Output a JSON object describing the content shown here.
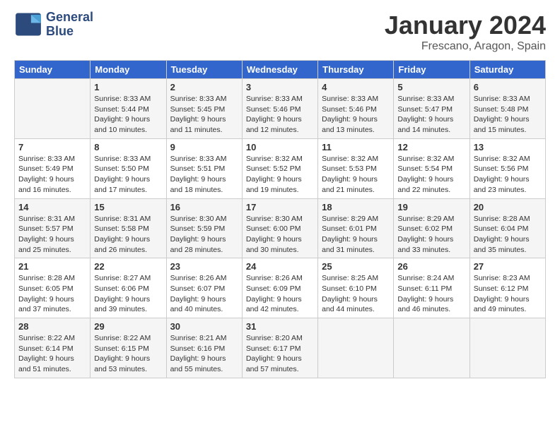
{
  "header": {
    "logo_line1": "General",
    "logo_line2": "Blue",
    "title": "January 2024",
    "location": "Frescano, Aragon, Spain"
  },
  "weekdays": [
    "Sunday",
    "Monday",
    "Tuesday",
    "Wednesday",
    "Thursday",
    "Friday",
    "Saturday"
  ],
  "weeks": [
    [
      {
        "day": "",
        "sunrise": "",
        "sunset": "",
        "daylight": ""
      },
      {
        "day": "1",
        "sunrise": "Sunrise: 8:33 AM",
        "sunset": "Sunset: 5:44 PM",
        "daylight": "Daylight: 9 hours and 10 minutes."
      },
      {
        "day": "2",
        "sunrise": "Sunrise: 8:33 AM",
        "sunset": "Sunset: 5:45 PM",
        "daylight": "Daylight: 9 hours and 11 minutes."
      },
      {
        "day": "3",
        "sunrise": "Sunrise: 8:33 AM",
        "sunset": "Sunset: 5:46 PM",
        "daylight": "Daylight: 9 hours and 12 minutes."
      },
      {
        "day": "4",
        "sunrise": "Sunrise: 8:33 AM",
        "sunset": "Sunset: 5:46 PM",
        "daylight": "Daylight: 9 hours and 13 minutes."
      },
      {
        "day": "5",
        "sunrise": "Sunrise: 8:33 AM",
        "sunset": "Sunset: 5:47 PM",
        "daylight": "Daylight: 9 hours and 14 minutes."
      },
      {
        "day": "6",
        "sunrise": "Sunrise: 8:33 AM",
        "sunset": "Sunset: 5:48 PM",
        "daylight": "Daylight: 9 hours and 15 minutes."
      }
    ],
    [
      {
        "day": "7",
        "sunrise": "Sunrise: 8:33 AM",
        "sunset": "Sunset: 5:49 PM",
        "daylight": "Daylight: 9 hours and 16 minutes."
      },
      {
        "day": "8",
        "sunrise": "Sunrise: 8:33 AM",
        "sunset": "Sunset: 5:50 PM",
        "daylight": "Daylight: 9 hours and 17 minutes."
      },
      {
        "day": "9",
        "sunrise": "Sunrise: 8:33 AM",
        "sunset": "Sunset: 5:51 PM",
        "daylight": "Daylight: 9 hours and 18 minutes."
      },
      {
        "day": "10",
        "sunrise": "Sunrise: 8:32 AM",
        "sunset": "Sunset: 5:52 PM",
        "daylight": "Daylight: 9 hours and 19 minutes."
      },
      {
        "day": "11",
        "sunrise": "Sunrise: 8:32 AM",
        "sunset": "Sunset: 5:53 PM",
        "daylight": "Daylight: 9 hours and 21 minutes."
      },
      {
        "day": "12",
        "sunrise": "Sunrise: 8:32 AM",
        "sunset": "Sunset: 5:54 PM",
        "daylight": "Daylight: 9 hours and 22 minutes."
      },
      {
        "day": "13",
        "sunrise": "Sunrise: 8:32 AM",
        "sunset": "Sunset: 5:56 PM",
        "daylight": "Daylight: 9 hours and 23 minutes."
      }
    ],
    [
      {
        "day": "14",
        "sunrise": "Sunrise: 8:31 AM",
        "sunset": "Sunset: 5:57 PM",
        "daylight": "Daylight: 9 hours and 25 minutes."
      },
      {
        "day": "15",
        "sunrise": "Sunrise: 8:31 AM",
        "sunset": "Sunset: 5:58 PM",
        "daylight": "Daylight: 9 hours and 26 minutes."
      },
      {
        "day": "16",
        "sunrise": "Sunrise: 8:30 AM",
        "sunset": "Sunset: 5:59 PM",
        "daylight": "Daylight: 9 hours and 28 minutes."
      },
      {
        "day": "17",
        "sunrise": "Sunrise: 8:30 AM",
        "sunset": "Sunset: 6:00 PM",
        "daylight": "Daylight: 9 hours and 30 minutes."
      },
      {
        "day": "18",
        "sunrise": "Sunrise: 8:29 AM",
        "sunset": "Sunset: 6:01 PM",
        "daylight": "Daylight: 9 hours and 31 minutes."
      },
      {
        "day": "19",
        "sunrise": "Sunrise: 8:29 AM",
        "sunset": "Sunset: 6:02 PM",
        "daylight": "Daylight: 9 hours and 33 minutes."
      },
      {
        "day": "20",
        "sunrise": "Sunrise: 8:28 AM",
        "sunset": "Sunset: 6:04 PM",
        "daylight": "Daylight: 9 hours and 35 minutes."
      }
    ],
    [
      {
        "day": "21",
        "sunrise": "Sunrise: 8:28 AM",
        "sunset": "Sunset: 6:05 PM",
        "daylight": "Daylight: 9 hours and 37 minutes."
      },
      {
        "day": "22",
        "sunrise": "Sunrise: 8:27 AM",
        "sunset": "Sunset: 6:06 PM",
        "daylight": "Daylight: 9 hours and 39 minutes."
      },
      {
        "day": "23",
        "sunrise": "Sunrise: 8:26 AM",
        "sunset": "Sunset: 6:07 PM",
        "daylight": "Daylight: 9 hours and 40 minutes."
      },
      {
        "day": "24",
        "sunrise": "Sunrise: 8:26 AM",
        "sunset": "Sunset: 6:09 PM",
        "daylight": "Daylight: 9 hours and 42 minutes."
      },
      {
        "day": "25",
        "sunrise": "Sunrise: 8:25 AM",
        "sunset": "Sunset: 6:10 PM",
        "daylight": "Daylight: 9 hours and 44 minutes."
      },
      {
        "day": "26",
        "sunrise": "Sunrise: 8:24 AM",
        "sunset": "Sunset: 6:11 PM",
        "daylight": "Daylight: 9 hours and 46 minutes."
      },
      {
        "day": "27",
        "sunrise": "Sunrise: 8:23 AM",
        "sunset": "Sunset: 6:12 PM",
        "daylight": "Daylight: 9 hours and 49 minutes."
      }
    ],
    [
      {
        "day": "28",
        "sunrise": "Sunrise: 8:22 AM",
        "sunset": "Sunset: 6:14 PM",
        "daylight": "Daylight: 9 hours and 51 minutes."
      },
      {
        "day": "29",
        "sunrise": "Sunrise: 8:22 AM",
        "sunset": "Sunset: 6:15 PM",
        "daylight": "Daylight: 9 hours and 53 minutes."
      },
      {
        "day": "30",
        "sunrise": "Sunrise: 8:21 AM",
        "sunset": "Sunset: 6:16 PM",
        "daylight": "Daylight: 9 hours and 55 minutes."
      },
      {
        "day": "31",
        "sunrise": "Sunrise: 8:20 AM",
        "sunset": "Sunset: 6:17 PM",
        "daylight": "Daylight: 9 hours and 57 minutes."
      },
      {
        "day": "",
        "sunrise": "",
        "sunset": "",
        "daylight": ""
      },
      {
        "day": "",
        "sunrise": "",
        "sunset": "",
        "daylight": ""
      },
      {
        "day": "",
        "sunrise": "",
        "sunset": "",
        "daylight": ""
      }
    ]
  ]
}
